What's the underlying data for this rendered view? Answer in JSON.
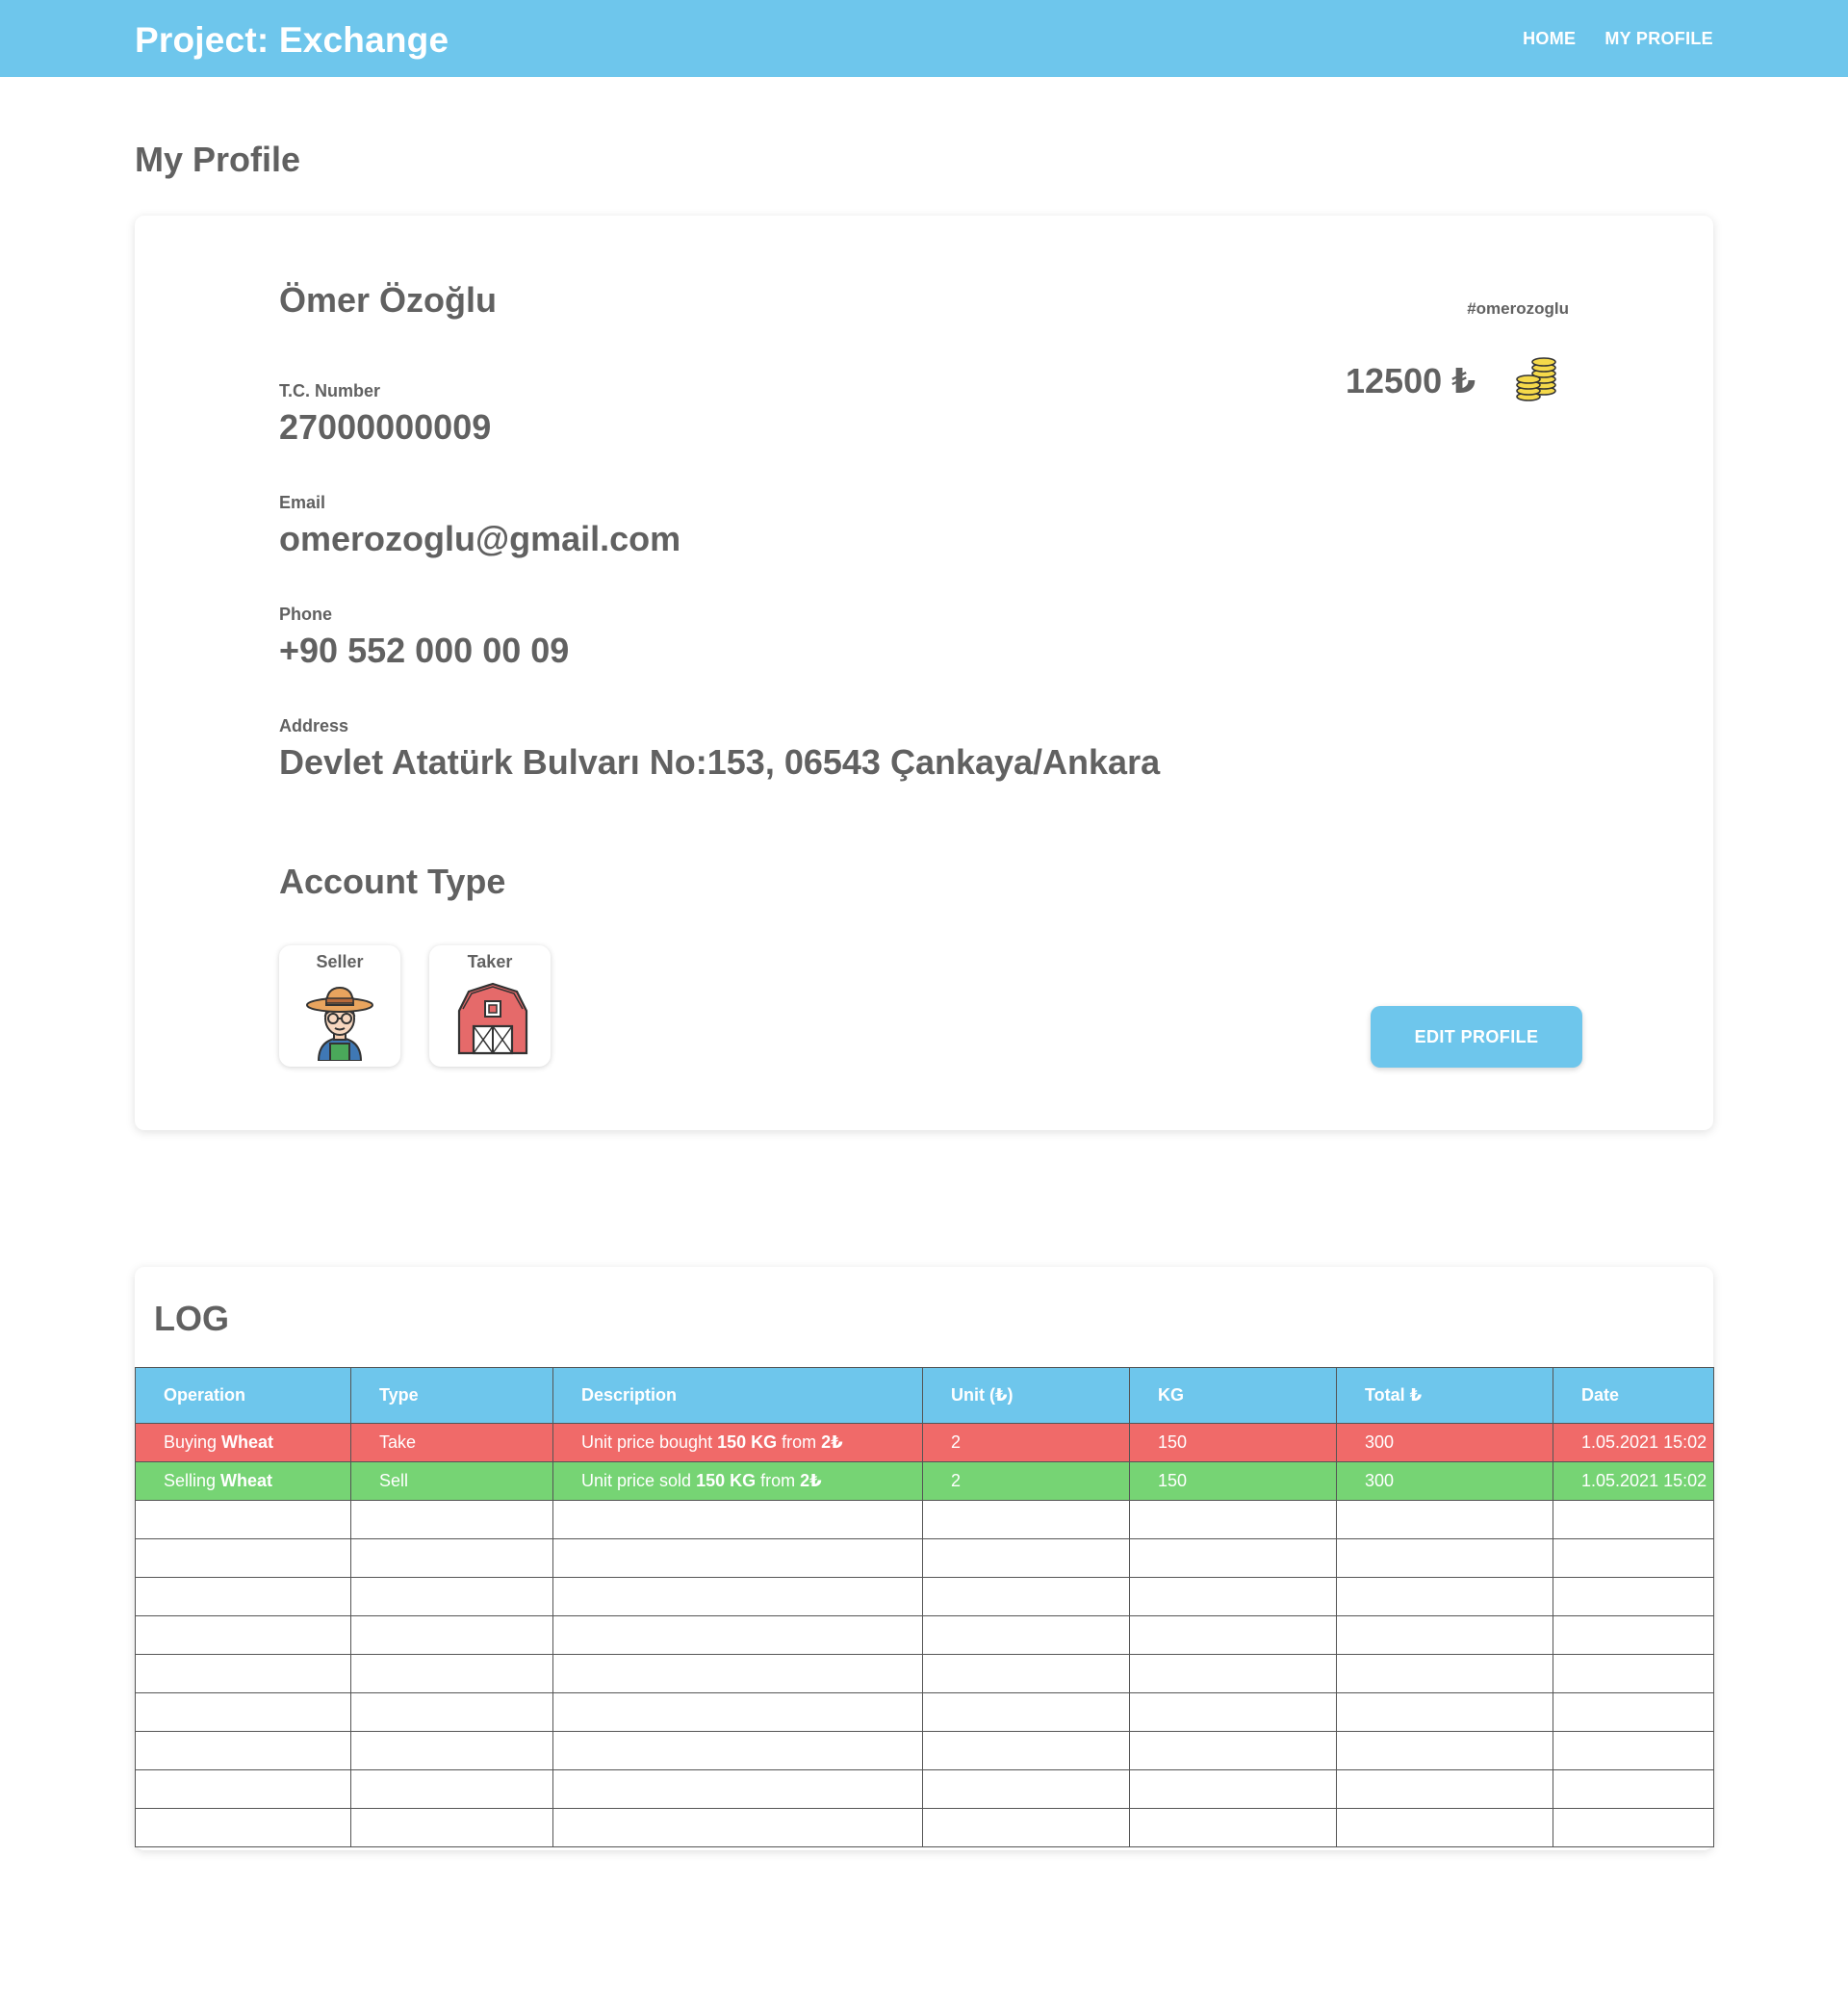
{
  "app": {
    "brand": "Project: Exchange"
  },
  "nav": {
    "items": [
      {
        "label": "HOME"
      },
      {
        "label": "MY PROFILE"
      }
    ]
  },
  "page": {
    "title": "My Profile"
  },
  "profile": {
    "full_name": "Ömer Özoğlu",
    "username": "#omerozoglu",
    "balance": "12500 ₺",
    "fields": {
      "tc": {
        "label": "T.C. Number",
        "value": "27000000009"
      },
      "email": {
        "label": "Email",
        "value": "omerozoglu@gmail.com"
      },
      "phone": {
        "label": "Phone",
        "value": "+90 552 000 00 09"
      },
      "address": {
        "label": "Address",
        "value": "Devlet Atatürk Bulvarı No:153, 06543 Çankaya/Ankara"
      }
    },
    "account_type": {
      "title": "Account Type",
      "options": [
        {
          "label": "Seller",
          "icon": "farmer-icon"
        },
        {
          "label": "Taker",
          "icon": "barn-icon"
        }
      ]
    },
    "edit_label": "EDIT PROFILE"
  },
  "colors": {
    "primary": "#6ec6ec",
    "buy_row": "#f06a69",
    "sell_row": "#76d474",
    "text": "#616161"
  },
  "log": {
    "title": "LOG",
    "columns": [
      "Operation",
      "Type",
      "Description",
      "Unit (₺)",
      "KG",
      "Total ₺",
      "Date"
    ],
    "rows": [
      {
        "kind": "buy",
        "operation_prefix": "Buying ",
        "operation_product": "Wheat",
        "type": "Take",
        "desc_pre": "Unit price bought ",
        "desc_kg": "150 KG",
        "desc_mid": " from ",
        "desc_price": "2₺",
        "unit": "2",
        "kg": "150",
        "total": "300",
        "date": "1.05.2021 15:02"
      },
      {
        "kind": "sell",
        "operation_prefix": "Selling ",
        "operation_product": "Wheat",
        "type": "Sell",
        "desc_pre": "Unit price sold ",
        "desc_kg": "150 KG",
        "desc_mid": " from ",
        "desc_price": "2₺",
        "unit": "2",
        "kg": "150",
        "total": "300",
        "date": "1.05.2021 15:02"
      }
    ],
    "empty_rows": 9
  }
}
